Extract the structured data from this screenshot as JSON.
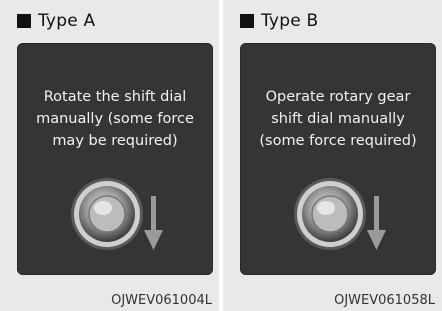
{
  "panels": [
    {
      "type_label": "Type A",
      "message_lines": [
        "Rotate the shift dial",
        "manually (some force",
        "may be required)"
      ],
      "image_code": "OJWEV061004L"
    },
    {
      "type_label": "Type B",
      "message_lines": [
        "Operate rotary gear",
        "shift dial manually",
        "(some force required)"
      ],
      "image_code": "OJWEV061058L"
    }
  ],
  "icons": {
    "bullet": "black-square-icon",
    "dial": "rotary-shift-dial-icon",
    "arrow": "arrow-down-icon"
  }
}
